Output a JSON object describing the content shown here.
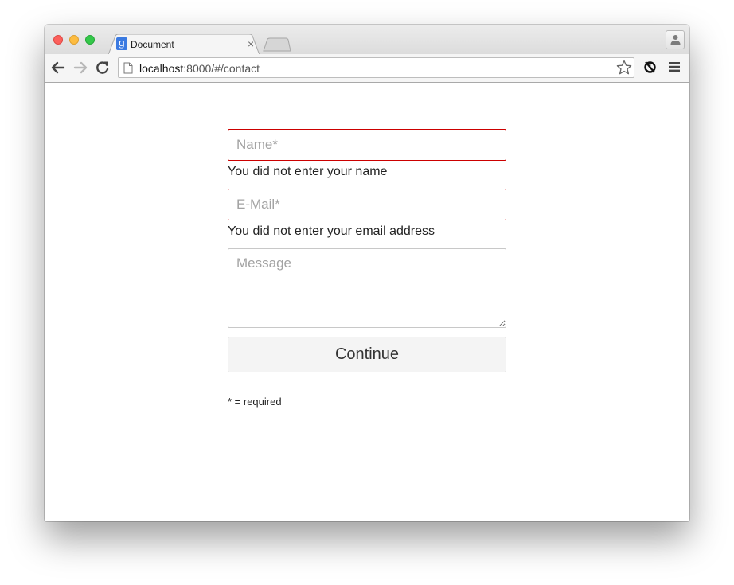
{
  "browser": {
    "tab_title": "Document",
    "tab_favicon_letter": "g",
    "url_host": "localhost",
    "url_rest": ":8000/#/contact"
  },
  "form": {
    "name_placeholder": "Name*",
    "name_error": "You did not enter your name",
    "email_placeholder": "E-Mail*",
    "email_error": "You did not enter your email address",
    "message_placeholder": "Message",
    "continue_label": "Continue",
    "required_note": "* = required"
  },
  "colors": {
    "error_border": "#cc0000",
    "button_bg": "#f4f4f4"
  },
  "icons": [
    "close-window",
    "minimize-window",
    "maximize-window",
    "favicon",
    "close-tab-icon",
    "profile-icon",
    "back-arrow-icon",
    "forward-arrow-icon",
    "reload-icon",
    "page-icon",
    "star-icon",
    "extension-icon",
    "menu-icon"
  ]
}
